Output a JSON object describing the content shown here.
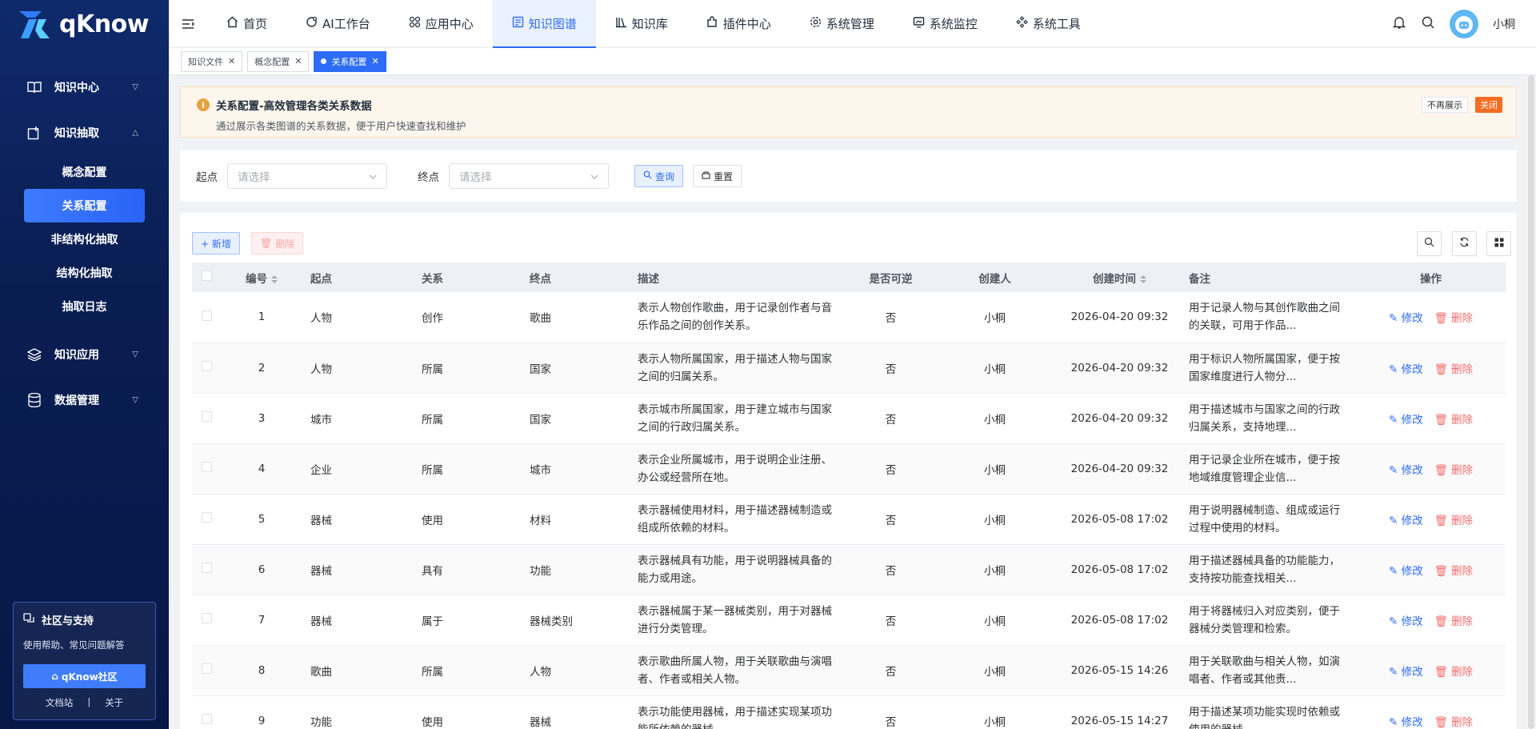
{
  "app": {
    "name": "qKnow"
  },
  "sidebar": {
    "items": [
      {
        "label": "知识中心",
        "icon": "book-icon"
      },
      {
        "label": "知识抽取",
        "icon": "extract-icon"
      },
      {
        "label": "知识应用",
        "icon": "layers-icon"
      },
      {
        "label": "数据管理",
        "icon": "database-icon"
      }
    ],
    "sub_items": [
      {
        "label": "概念配置"
      },
      {
        "label": "关系配置"
      },
      {
        "label": "非结构化抽取"
      },
      {
        "label": "结构化抽取"
      },
      {
        "label": "抽取日志"
      }
    ],
    "community": {
      "title": "社区与支持",
      "desc": "使用帮助、常见问题解答",
      "button": "qKnow社区",
      "link_docs": "文档站",
      "link_sep": "|",
      "link_about": "关于"
    }
  },
  "topnav": {
    "items": [
      {
        "label": "首页",
        "icon": "home-icon"
      },
      {
        "label": "AI工作台",
        "icon": "ai-icon"
      },
      {
        "label": "应用中心",
        "icon": "apps-icon"
      },
      {
        "label": "知识图谱",
        "icon": "graph-icon"
      },
      {
        "label": "知识库",
        "icon": "library-icon"
      },
      {
        "label": "插件中心",
        "icon": "plugin-icon"
      },
      {
        "label": "系统管理",
        "icon": "settings-icon"
      },
      {
        "label": "系统监控",
        "icon": "monitor-icon"
      },
      {
        "label": "系统工具",
        "icon": "tools-icon"
      }
    ],
    "active_index": 3,
    "user": "小桐"
  },
  "tabs": [
    {
      "label": "知识文件"
    },
    {
      "label": "概念配置"
    },
    {
      "label": "关系配置"
    }
  ],
  "notice": {
    "title": "关系配置-高效管理各类关系数据",
    "subtitle": "通过展示各类图谱的关系数据，便于用户快速查找和维护",
    "no_show": "不再展示",
    "close": "关闭"
  },
  "search": {
    "start_label": "起点",
    "start_placeholder": "请选择",
    "end_label": "终点",
    "end_placeholder": "请选择",
    "query": "查询",
    "reset": "重置"
  },
  "toolbar": {
    "add": "+ 新增",
    "delete": "删除"
  },
  "table": {
    "headers": [
      "编号",
      "起点",
      "关系",
      "终点",
      "描述",
      "是否可逆",
      "创建人",
      "创建时间",
      "备注",
      "操作"
    ],
    "edit_label": "修改",
    "delete_label": "删除",
    "rows": [
      {
        "id": "1",
        "start": "人物",
        "rel": "创作",
        "end": "歌曲",
        "desc": "表示人物创作歌曲，用于记录创作者与音乐作品之间的创作关系。",
        "rev": "否",
        "creator": "小桐",
        "time": "2026-04-20 09:32",
        "note": "用于记录人物与其创作歌曲之间的关联，可用于作品..."
      },
      {
        "id": "2",
        "start": "人物",
        "rel": "所属",
        "end": "国家",
        "desc": "表示人物所属国家，用于描述人物与国家之间的归属关系。",
        "rev": "否",
        "creator": "小桐",
        "time": "2026-04-20 09:32",
        "note": "用于标识人物所属国家，便于按国家维度进行人物分..."
      },
      {
        "id": "3",
        "start": "城市",
        "rel": "所属",
        "end": "国家",
        "desc": "表示城市所属国家，用于建立城市与国家之间的行政归属关系。",
        "rev": "否",
        "creator": "小桐",
        "time": "2026-04-20 09:32",
        "note": "用于描述城市与国家之间的行政归属关系，支持地理..."
      },
      {
        "id": "4",
        "start": "企业",
        "rel": "所属",
        "end": "城市",
        "desc": "表示企业所属城市，用于说明企业注册、办公或经营所在地。",
        "rev": "否",
        "creator": "小桐",
        "time": "2026-04-20 09:32",
        "note": "用于记录企业所在城市，便于按地域维度管理企业信..."
      },
      {
        "id": "5",
        "start": "器械",
        "rel": "使用",
        "end": "材料",
        "desc": "表示器械使用材料，用于描述器械制造或组成所依赖的材料。",
        "rev": "否",
        "creator": "小桐",
        "time": "2026-05-08 17:02",
        "note": "用于说明器械制造、组成或运行过程中使用的材料。"
      },
      {
        "id": "6",
        "start": "器械",
        "rel": "具有",
        "end": "功能",
        "desc": "表示器械具有功能，用于说明器械具备的能力或用途。",
        "rev": "否",
        "creator": "小桐",
        "time": "2026-05-08 17:02",
        "note": "用于描述器械具备的功能能力，支持按功能查找相关..."
      },
      {
        "id": "7",
        "start": "器械",
        "rel": "属于",
        "end": "器械类别",
        "desc": "表示器械属于某一器械类别，用于对器械进行分类管理。",
        "rev": "否",
        "creator": "小桐",
        "time": "2026-05-08 17:02",
        "note": "用于将器械归入对应类别，便于器械分类管理和检索。"
      },
      {
        "id": "8",
        "start": "歌曲",
        "rel": "所属",
        "end": "人物",
        "desc": "表示歌曲所属人物，用于关联歌曲与演唱者、作者或相关人物。",
        "rev": "否",
        "creator": "小桐",
        "time": "2026-05-15 14:26",
        "note": "用于关联歌曲与相关人物，如演唱者、作者或其他责..."
      },
      {
        "id": "9",
        "start": "功能",
        "rel": "使用",
        "end": "器械",
        "desc": "表示功能使用器械，用于描述实现某项功能所依赖的器械。",
        "rev": "否",
        "creator": "小桐",
        "time": "2026-05-15 14:27",
        "note": "用于描述某项功能实现时依赖或使用的器械。"
      }
    ]
  }
}
